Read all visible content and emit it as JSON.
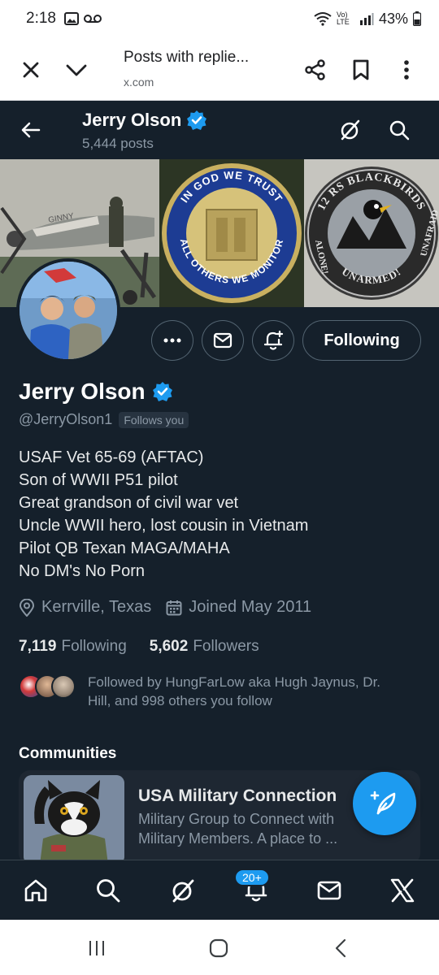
{
  "status_bar": {
    "time": "2:18",
    "battery": "43%",
    "network": "Vo) LTE"
  },
  "browser": {
    "title": "Posts with replie...",
    "url": "x.com",
    "icons": [
      "close-icon",
      "chevron-down-icon",
      "share-icon",
      "bookmark-icon",
      "more-vertical-icon"
    ]
  },
  "header": {
    "name": "Jerry Olson",
    "posts_count": "5,444 posts",
    "icons": [
      "back-arrow-icon",
      "grok-icon",
      "search-icon"
    ]
  },
  "profile": {
    "name": "Jerry Olson",
    "handle": "@JerryOlson1",
    "follows_you": "Follows you",
    "following_button": "Following",
    "bio": [
      "USAF Vet 65-69 (AFTAC)",
      "Son of WWII P51 pilot",
      "Great grandson of civil war vet",
      "Uncle WWII hero, lost cousin in Vietnam",
      "Pilot QB Texan MAGA/MAHA",
      "No DM's No Porn"
    ],
    "location": "Kerrville, Texas",
    "joined": "Joined May 2011",
    "following_count": "7,119",
    "following_label": "Following",
    "followers_count": "5,602",
    "followers_label": "Followers",
    "followed_by_line1": "Followed by HungFarLow aka Hugh Jaynus, Dr.",
    "followed_by_line2": "Hill, and 998 others you follow"
  },
  "banner": {
    "coin_top": "IN GOD WE TRUST",
    "coin_bottom": "ALL OTHERS WE MONITOR",
    "patch_top": "12 RS BLACKBIRDS",
    "patch_left": "ALONE!",
    "patch_bottom": "UNARMED!",
    "patch_right": "UNAFRAID"
  },
  "communities": {
    "heading": "Communities",
    "card_title": "USA Military Connection",
    "card_desc_line1": "Military Group to Connect with",
    "card_desc_line2": "Military Members. A place to ..."
  },
  "bottom_nav": {
    "notifications_badge": "20+",
    "icons": [
      "home-icon",
      "search-icon",
      "grok-icon",
      "notifications-icon",
      "messages-icon",
      "x-logo-icon"
    ]
  },
  "colors": {
    "background": "#15202b",
    "accent": "#1d9bf0",
    "muted_text": "#8b98a5",
    "border": "#536471"
  }
}
